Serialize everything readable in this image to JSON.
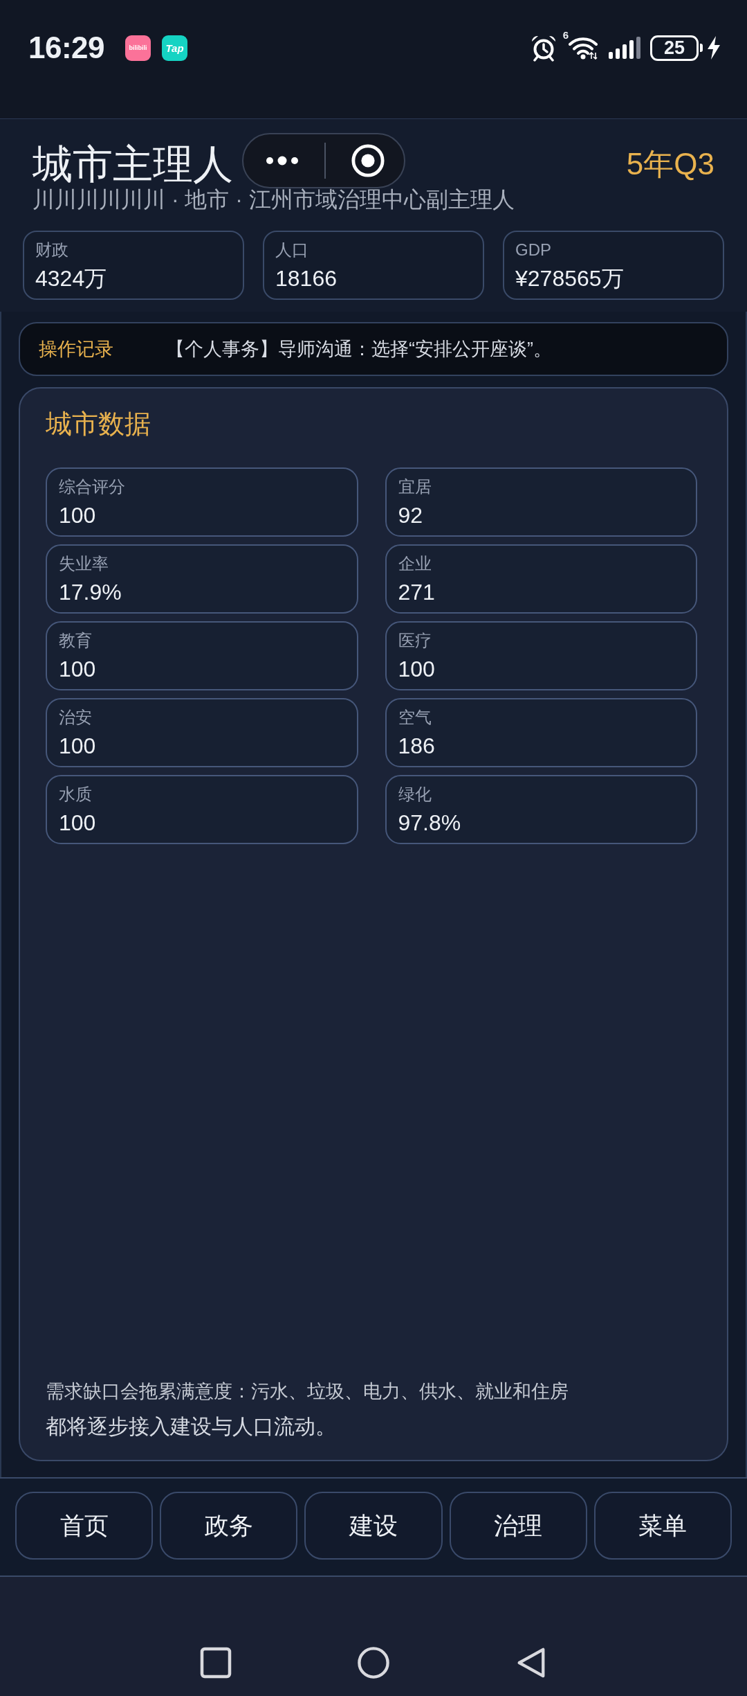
{
  "status_bar": {
    "time": "16:29",
    "app_logos": [
      {
        "label": "bilibili",
        "color": "#fb7299"
      },
      {
        "label": "Tap",
        "color": "#15d3c3"
      }
    ],
    "wifi_label": "6",
    "battery": "25"
  },
  "header": {
    "title": "城市主理人",
    "subtitle": "川川川川川川 · 地市 · 江州市域治理中心副主理人",
    "period": "5年Q3",
    "stats": [
      {
        "label": "财政",
        "value": "4324万"
      },
      {
        "label": "人口",
        "value": "18166"
      },
      {
        "label": "GDP",
        "value": "¥278565万"
      }
    ]
  },
  "activity_log": {
    "label": "操作记录",
    "text": "【个人事务】导师沟通：选择“安排公开座谈”。"
  },
  "city_data": {
    "title": "城市数据",
    "metrics": [
      {
        "label": "综合评分",
        "value": "100"
      },
      {
        "label": "宜居",
        "value": "92"
      },
      {
        "label": "失业率",
        "value": "17.9%"
      },
      {
        "label": "企业",
        "value": "271"
      },
      {
        "label": "教育",
        "value": "100"
      },
      {
        "label": "医疗",
        "value": "100"
      },
      {
        "label": "治安",
        "value": "100"
      },
      {
        "label": "空气",
        "value": "186"
      },
      {
        "label": "水质",
        "value": "100"
      },
      {
        "label": "绿化",
        "value": "97.8%"
      }
    ],
    "hint": "需求缺口会拖累满意度：污水、垃圾、电力、供水、就业和住房",
    "note": "都将逐步接入建设与人口流动。"
  },
  "bottom_nav": [
    "首页",
    "政务",
    "建设",
    "治理",
    "菜单"
  ]
}
